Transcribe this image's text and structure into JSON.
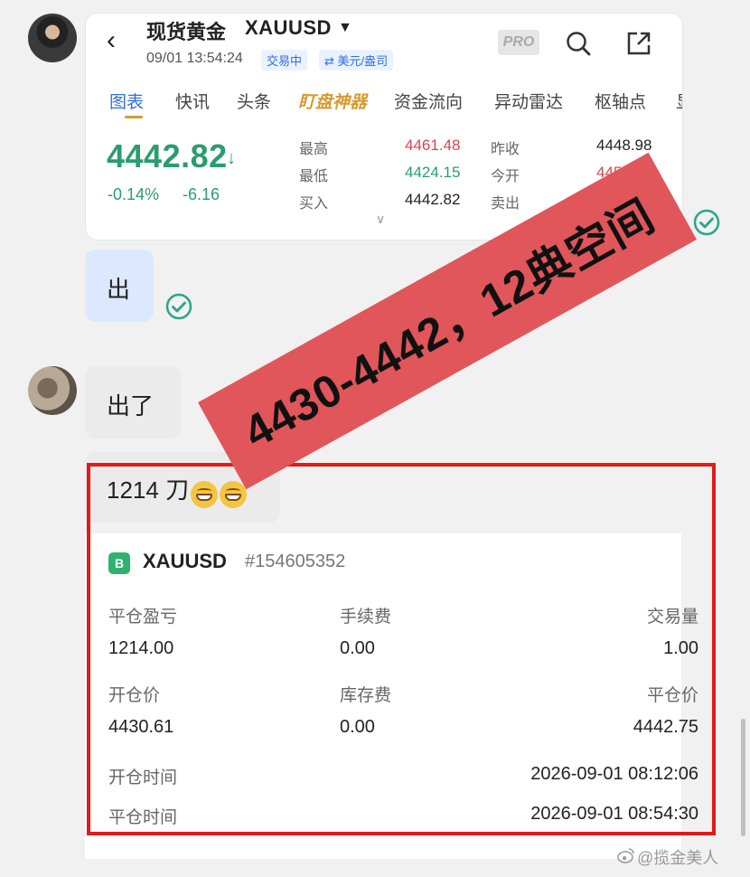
{
  "quote": {
    "title": "现货黄金",
    "symbol": "XAUUSD",
    "datetime": "09/01 13:54:24",
    "status_badge": "交易中",
    "currency_badge": "⇄ 美元/盎司",
    "pro_label": "PRO",
    "tabs": [
      "图表",
      "快讯",
      "头条",
      "盯盘神器",
      "资金流向",
      "异动雷达",
      "枢轴点",
      "显"
    ],
    "price": "4442.82",
    "change_pct": "-0.14%",
    "change_abs": "-6.16",
    "stats": {
      "high_label": "最高",
      "high": "4461.48",
      "low_label": "最低",
      "low": "4424.15",
      "bid_label": "买入",
      "bid": "4442.82",
      "prev_close_label": "昨收",
      "prev_close": "4448.98",
      "open_label": "今开",
      "open": "4451.59",
      "ask_label": "卖出",
      "ask": ""
    }
  },
  "messages": {
    "me_1": "出",
    "them_1": "出了",
    "them_2": "1214 刀"
  },
  "order": {
    "badge": "B",
    "symbol": "XAUUSD",
    "id": "#154605352",
    "pnl_label": "平仓盈亏",
    "pnl": "1214.00",
    "fee_label": "手续费",
    "fee": "0.00",
    "volume_label": "交易量",
    "volume": "1.00",
    "open_price_label": "开仓价",
    "open_price": "4430.61",
    "swap_label": "库存费",
    "swap": "0.00",
    "close_price_label": "平仓价",
    "close_price": "4442.75",
    "open_time_label": "开仓时间",
    "open_time": "2026-09-01 08:12:06",
    "close_time_label": "平仓时间",
    "close_time": "2026-09-01 08:54:30"
  },
  "overlay": {
    "banner_text": "4430-4442，12典空间"
  },
  "watermark": "@揽金美人",
  "colors": {
    "up_green": "#2a9d6f",
    "down_red": "#d9434f",
    "accent_blue": "#2f6fe4",
    "frame_red": "#e11a1a",
    "banner_red": "#e0565a"
  }
}
